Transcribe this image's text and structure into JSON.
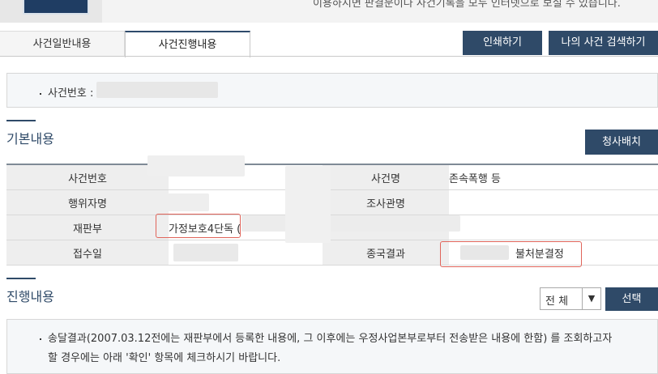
{
  "header": {
    "notice": "이용하시면 판결문이나 사건기록을 모두 인터넷으로 보실 수 있습니다."
  },
  "tabs": [
    {
      "label": "사건일반내용"
    },
    {
      "label": "사건진행내용"
    }
  ],
  "toolbar": {
    "print_label": "인쇄하기",
    "my_case_search_label": "나의 사건 검색하기"
  },
  "case_box": {
    "label": "사건번호 :"
  },
  "basic": {
    "title": "기본내용",
    "judge_assign_label": "청사배치",
    "rows": [
      {
        "h1": "사건번호",
        "v1": "",
        "h2": "사건명",
        "v2": "존속폭행 등"
      },
      {
        "h1": "행위자명",
        "v1": "",
        "h2": "조사관명",
        "v2": ""
      },
      {
        "h1": "재판부",
        "v1": "가정보호4단독 (",
        "h2": "",
        "v2": ""
      },
      {
        "h1": "접수일",
        "v1": "",
        "h2": "종국결과",
        "v2": "불처분결정"
      }
    ]
  },
  "progress": {
    "title": "진행내용",
    "filter_value": "전 체",
    "select_label": "선택",
    "note_line1": "송달결과(2007.03.12전에는 재판부에서 등록한 내용에, 그 이후에는 우정사업본부로부터 전송받은 내용에 한함) 를 조회하고자",
    "note_line2": "할 경우에는 아래 '확인' 항목에 체크하시기 바랍니다."
  },
  "colors": {
    "primary": "#2f4a68",
    "highlight": "#e0645a"
  }
}
